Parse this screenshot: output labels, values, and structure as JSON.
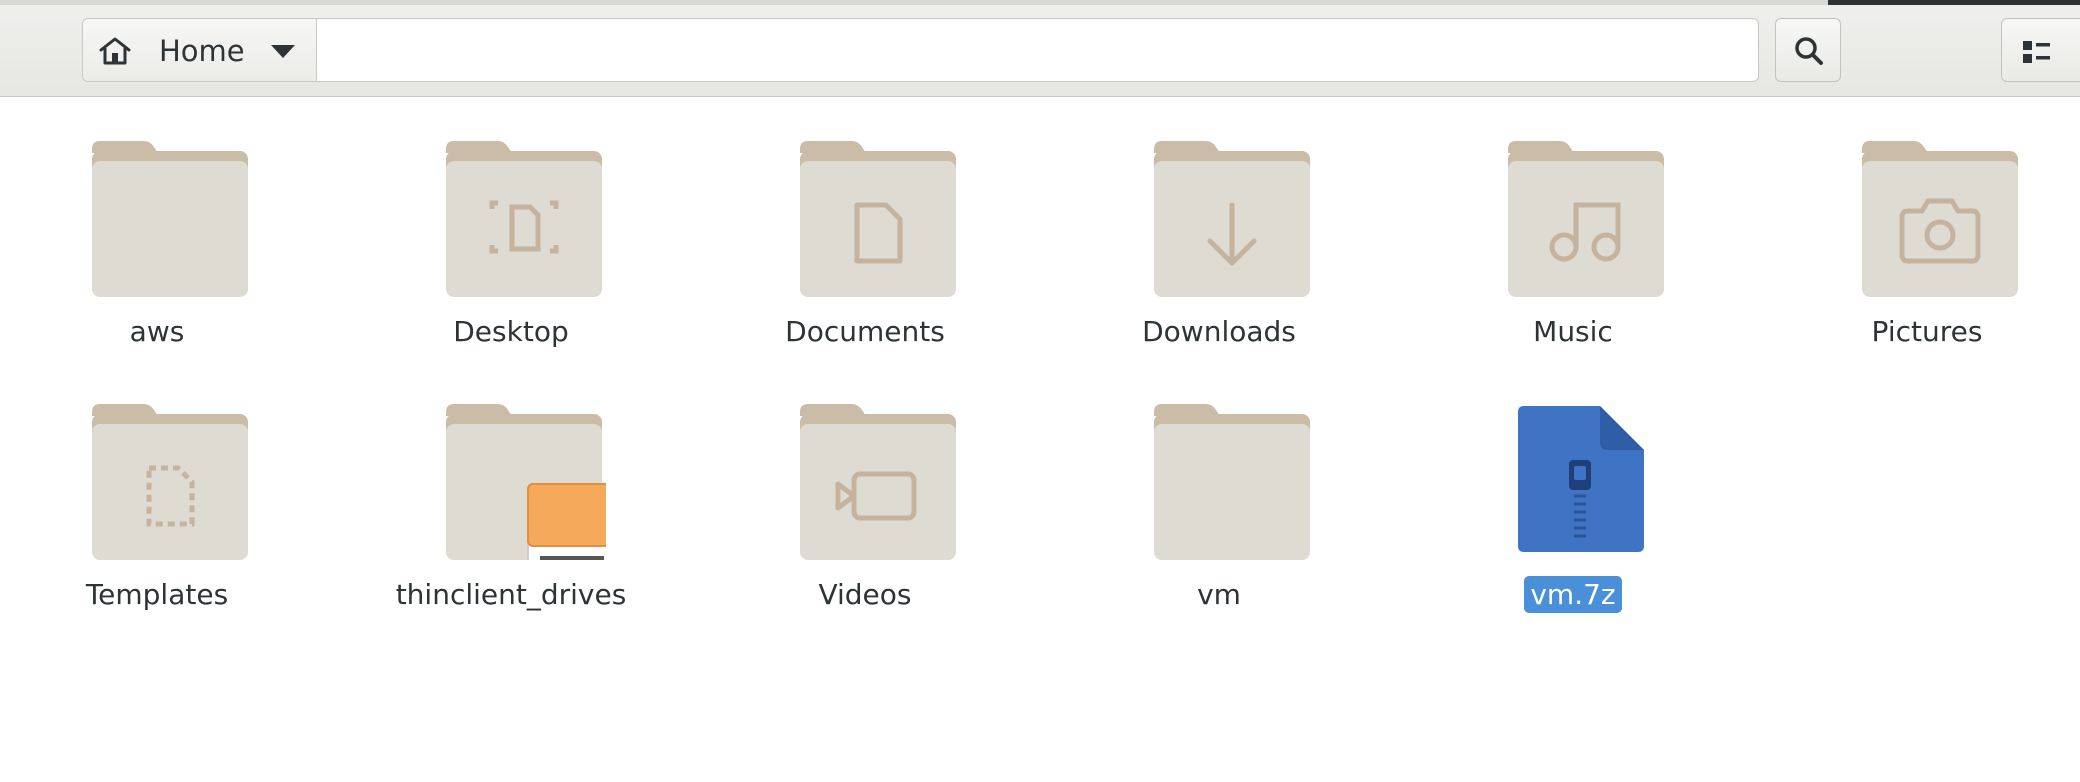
{
  "window": {
    "accent_color": "#4a90d9",
    "folder_color": "#dcd8ce",
    "folder_tab_color": "#cbbca8"
  },
  "header": {
    "path": {
      "label": "Home",
      "icon": "home-icon",
      "dropdown_icon": "chevron-down-icon"
    },
    "location_value": "",
    "search_icon": "search-icon",
    "view_icon": "list-view-icon"
  },
  "items": [
    {
      "name": "aws",
      "type": "folder",
      "emblem": "none"
    },
    {
      "name": "Desktop",
      "type": "folder",
      "emblem": "desktop"
    },
    {
      "name": "Documents",
      "type": "folder",
      "emblem": "document"
    },
    {
      "name": "Downloads",
      "type": "folder",
      "emblem": "download"
    },
    {
      "name": "Music",
      "type": "folder",
      "emblem": "music"
    },
    {
      "name": "Pictures",
      "type": "folder",
      "emblem": "camera"
    },
    {
      "name": "Templates",
      "type": "folder",
      "emblem": "template"
    },
    {
      "name": "thinclient_drives",
      "type": "folder",
      "emblem": "drive"
    },
    {
      "name": "Videos",
      "type": "folder",
      "emblem": "video"
    },
    {
      "name": "vm",
      "type": "folder",
      "emblem": "none"
    },
    {
      "name": "vm.7z",
      "type": "archive",
      "selected": true
    }
  ]
}
